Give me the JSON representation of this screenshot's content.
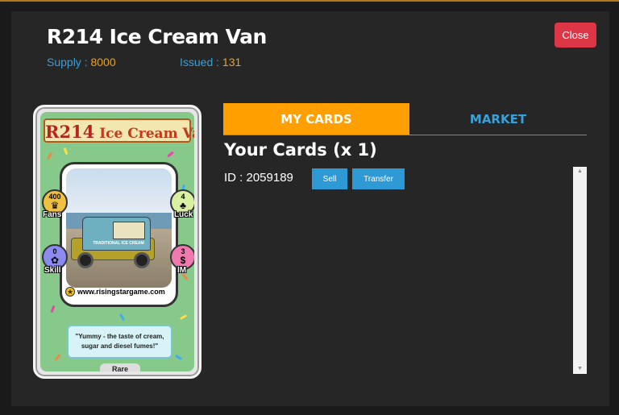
{
  "modal": {
    "title": "R214 Ice Cream Van",
    "supply_label": "Supply :",
    "supply_value": "8000",
    "issued_label": "Issued :",
    "issued_value": "131",
    "close_label": "Close"
  },
  "card": {
    "title_number": "R214",
    "title_name": "Ice Cream Van",
    "url": "www.risingstargame.com",
    "quote": "\"Yummy - the taste of cream, sugar and diesel fumes!\"",
    "rarity": "Rare",
    "stats": {
      "fans": {
        "value": "400",
        "label": "Fans"
      },
      "luck": {
        "value": "4",
        "label": "Luck"
      },
      "skill": {
        "value": "0",
        "label": "Skill"
      },
      "im": {
        "value": "3",
        "label": "IM"
      }
    },
    "van_sign": "TRADITIONAL ICE CREAM"
  },
  "tabs": {
    "my_cards": "MY CARDS",
    "market": "MARKET"
  },
  "content": {
    "heading": "Your Cards (x 1)",
    "id_text": "ID : 2059189",
    "sell_label": "Sell",
    "transfer_label": "Transfer"
  },
  "colors": {
    "accent_orange": "#ffa000",
    "link_blue": "#3aa0d8",
    "danger": "#dc3545",
    "action_blue": "#2d9ad6"
  }
}
